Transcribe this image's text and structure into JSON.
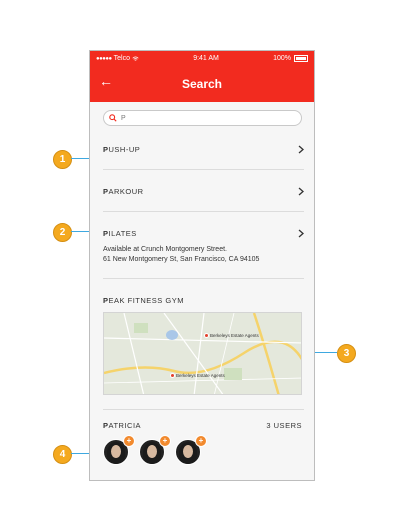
{
  "status_bar": {
    "carrier": "Telco",
    "time": "9:41 AM",
    "battery": "100%"
  },
  "nav": {
    "title": "Search",
    "back_icon": "arrow-left-icon"
  },
  "search": {
    "value": "P",
    "icon": "search-icon"
  },
  "results": [
    {
      "bold": "P",
      "rest": "USH-UP"
    },
    {
      "bold": "P",
      "rest": "ARKOUR"
    },
    {
      "bold": "P",
      "rest": "ILATES",
      "details": [
        "Available at Crunch Montgomery Street.",
        "61 New Montgomery St, San Francisco, CA 94105"
      ]
    }
  ],
  "place": {
    "bold": "P",
    "rest": "EAK FITNESS GYM",
    "map": {
      "markers": [
        "Berkeleys Estate Agents",
        "Berkeleys Estate Agents"
      ]
    }
  },
  "users": {
    "bold": "P",
    "rest": "ATRICIA",
    "count": "3 USERS",
    "add_label": "+"
  },
  "callouts": [
    "1",
    "2",
    "3",
    "4"
  ],
  "colors": {
    "accent": "#f22b1f",
    "callout": "#f4a91f",
    "pointer": "#3ea8e0",
    "add": "#f28a2e"
  }
}
